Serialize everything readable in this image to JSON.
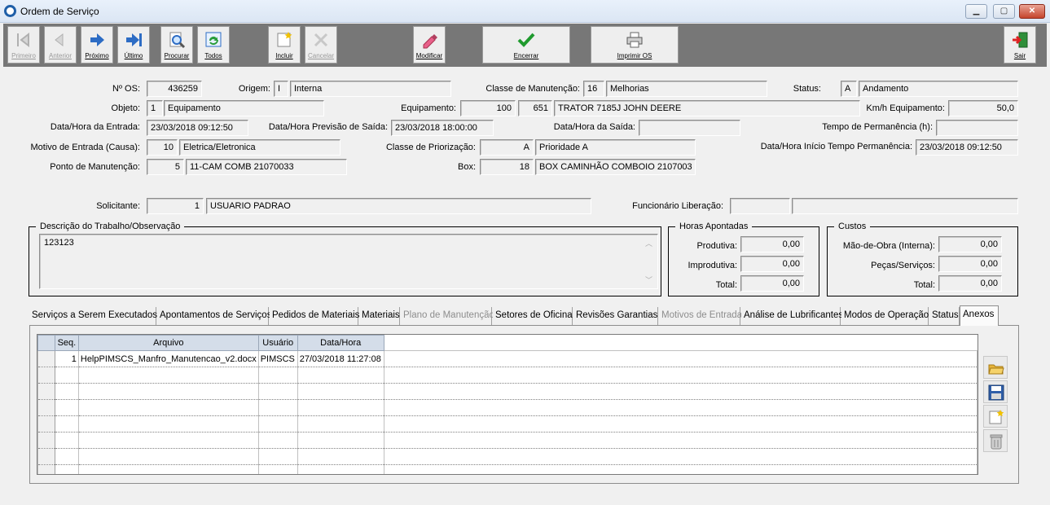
{
  "window": {
    "title": "Ordem de Serviço",
    "controls": {
      "minimize": "▁",
      "maximize": "▢",
      "close": "✕"
    }
  },
  "toolbar": {
    "primeiro": "Primeiro",
    "anterior": "Anterior",
    "proximo": "Próximo",
    "ultimo": "Último",
    "procurar": "Procurar",
    "todos": "Todos",
    "incluir": "Incluir",
    "cancelar": "Cancelar",
    "modificar": "Modificar",
    "encerrar": "Encerrar",
    "imprimir": "Imprimir OS",
    "sair": "Sair"
  },
  "form": {
    "os_label": "Nº OS:",
    "os_value": "436259",
    "origem_label": "Origem:",
    "origem_code": "I",
    "origem_desc": "Interna",
    "classe_label": "Classe de Manutenção:",
    "classe_code": "16",
    "classe_desc": "Melhorias",
    "status_label": "Status:",
    "status_code": "A",
    "status_desc": "Andamento",
    "objeto_label": "Objeto:",
    "objeto_code": "1",
    "objeto_desc": "Equipamento",
    "equip_label": "Equipamento:",
    "equip_code1": "100",
    "equip_code2": "651",
    "equip_desc": "TRATOR 7185J JOHN DEERE",
    "kmh_label": "Km/h Equipamento:",
    "kmh_value": "50,0",
    "entrada_label": "Data/Hora da Entrada:",
    "entrada_value": "23/03/2018 09:12:50",
    "previsao_label": "Data/Hora Previsão de Saída:",
    "previsao_value": "23/03/2018 18:00:00",
    "saida_label": "Data/Hora da Saída:",
    "saida_value": "",
    "permanencia_label": "Tempo de Permanência (h):",
    "permanencia_value": "",
    "motivo_label": "Motivo de Entrada (Causa):",
    "motivo_code": "10",
    "motivo_desc": "Eletrica/Eletronica",
    "prioriz_label": "Classe de Priorização:",
    "prioriz_code": "A",
    "prioriz_desc": "Prioridade A",
    "inicio_label": "Data/Hora Início Tempo Permanência:",
    "inicio_value": "23/03/2018 09:12:50",
    "ponto_label": "Ponto de Manutenção:",
    "ponto_code": "5",
    "ponto_desc": "11-CAM COMB 21070033",
    "box_label": "Box:",
    "box_code": "18",
    "box_desc": "BOX CAMINHÃO COMBOIO 2107003",
    "solicitante_label": "Solicitante:",
    "solicitante_code": "1",
    "solicitante_desc": "USUARIO PADRAO",
    "liberacao_label": "Funcionário Liberação:",
    "liberacao_code": "",
    "liberacao_desc": ""
  },
  "descricao": {
    "title": "Descrição do Trabalho/Observação",
    "text": "123123"
  },
  "horas": {
    "title": "Horas Apontadas",
    "produtiva_label": "Produtiva:",
    "produtiva": "0,00",
    "improdutiva_label": "Improdutiva:",
    "improdutiva": "0,00",
    "total_label": "Total:",
    "total": "0,00"
  },
  "custos": {
    "title": "Custos",
    "mao_label": "Mão-de-Obra (Interna):",
    "mao": "0,00",
    "pecas_label": "Peças/Serviços:",
    "pecas": "0,00",
    "total_label": "Total:",
    "total": "0,00"
  },
  "tabs": [
    {
      "label": "Serviços a Serem Executados",
      "disabled": false
    },
    {
      "label": "Apontamentos de Serviços",
      "disabled": false
    },
    {
      "label": "Pedidos de Materiais",
      "disabled": false
    },
    {
      "label": "Materiais",
      "disabled": false
    },
    {
      "label": "Plano de Manutenção",
      "disabled": true
    },
    {
      "label": "Setores de Oficina",
      "disabled": false
    },
    {
      "label": "Revisões Garantias",
      "disabled": false
    },
    {
      "label": "Motivos de Entrada",
      "disabled": true
    },
    {
      "label": "Análise de Lubrificantes",
      "disabled": false
    },
    {
      "label": "Modos de Operação",
      "disabled": false
    },
    {
      "label": "Status",
      "disabled": false
    },
    {
      "label": "Anexos",
      "active": true
    }
  ],
  "grid": {
    "columns": [
      "Seq.",
      "Arquivo",
      "Usuário",
      "Data/Hora"
    ],
    "rows": [
      {
        "seq": "1",
        "arquivo": "HelpPIMSCS_Manfro_Manutencao_v2.docx",
        "usuario": "PIMSCS",
        "datahora": "27/03/2018 11:27:08"
      }
    ]
  },
  "side_icons": [
    "open-folder-icon",
    "save-icon",
    "new-document-icon",
    "trash-icon"
  ]
}
